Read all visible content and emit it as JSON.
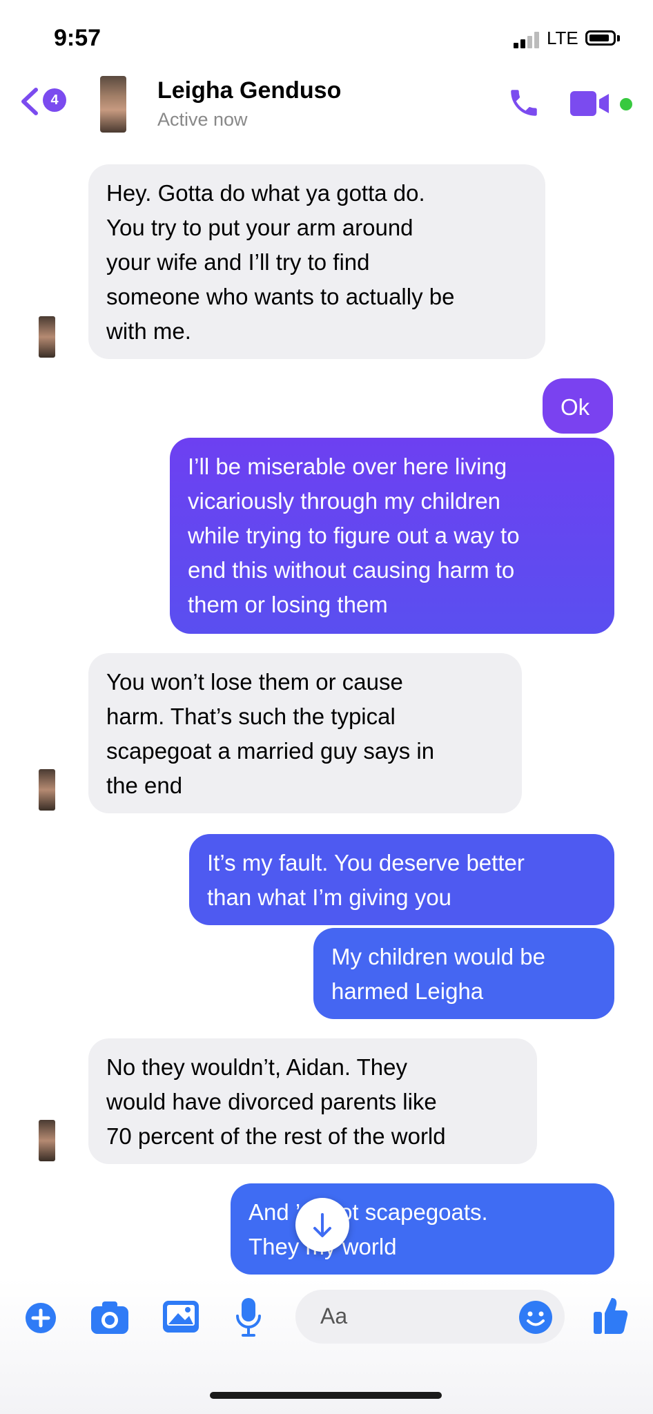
{
  "status_bar": {
    "time": "9:57",
    "network": "LTE"
  },
  "header": {
    "back_badge": "4",
    "contact_name": "Leigha Genduso",
    "contact_status": "Active now"
  },
  "messages": [
    {
      "from": "them",
      "text": "Hey. Gotta do what ya gotta do.\nYou try to put your arm around\nyour wife and I’ll try to find\nsomeone who wants to actually be\nwith me."
    },
    {
      "from": "me",
      "text": "Ok"
    },
    {
      "from": "me",
      "text": "I’ll be miserable over here living\nvicariously through my children\nwhile trying to figure out a way to\nend this without causing harm to\nthem or losing them"
    },
    {
      "from": "them",
      "text": "You won’t lose them or cause\nharm. That’s such the typical\nscapegoat a married guy says in\nthe end"
    },
    {
      "from": "me",
      "text": "It’s my fault. You deserve better\nthan what I’m giving you"
    },
    {
      "from": "me",
      "text": "My children would be\nharmed Leigha"
    },
    {
      "from": "them",
      "text": "No they wouldn’t, Aidan. They\nwould have divorced parents like\n70 percent of the rest of the world"
    },
    {
      "from": "me",
      "text": "And        ’re not scapegoats.\nThey        my world"
    }
  ],
  "composer": {
    "placeholder": "Aa"
  },
  "colors": {
    "accent": "#7b4bef",
    "incoming_bubble": "#efeff2",
    "outgoing_purple": "#7a42f0",
    "outgoing_blue": "#3f6cf3",
    "active_dot": "#37c93f",
    "composer_icons": "#2f7bf6"
  },
  "icons": [
    "back-chevron-icon",
    "phone-icon",
    "video-camera-icon",
    "arrow-down-icon",
    "plus-icon",
    "camera-icon",
    "photo-icon",
    "microphone-icon",
    "emoji-icon",
    "thumbs-up-icon"
  ]
}
